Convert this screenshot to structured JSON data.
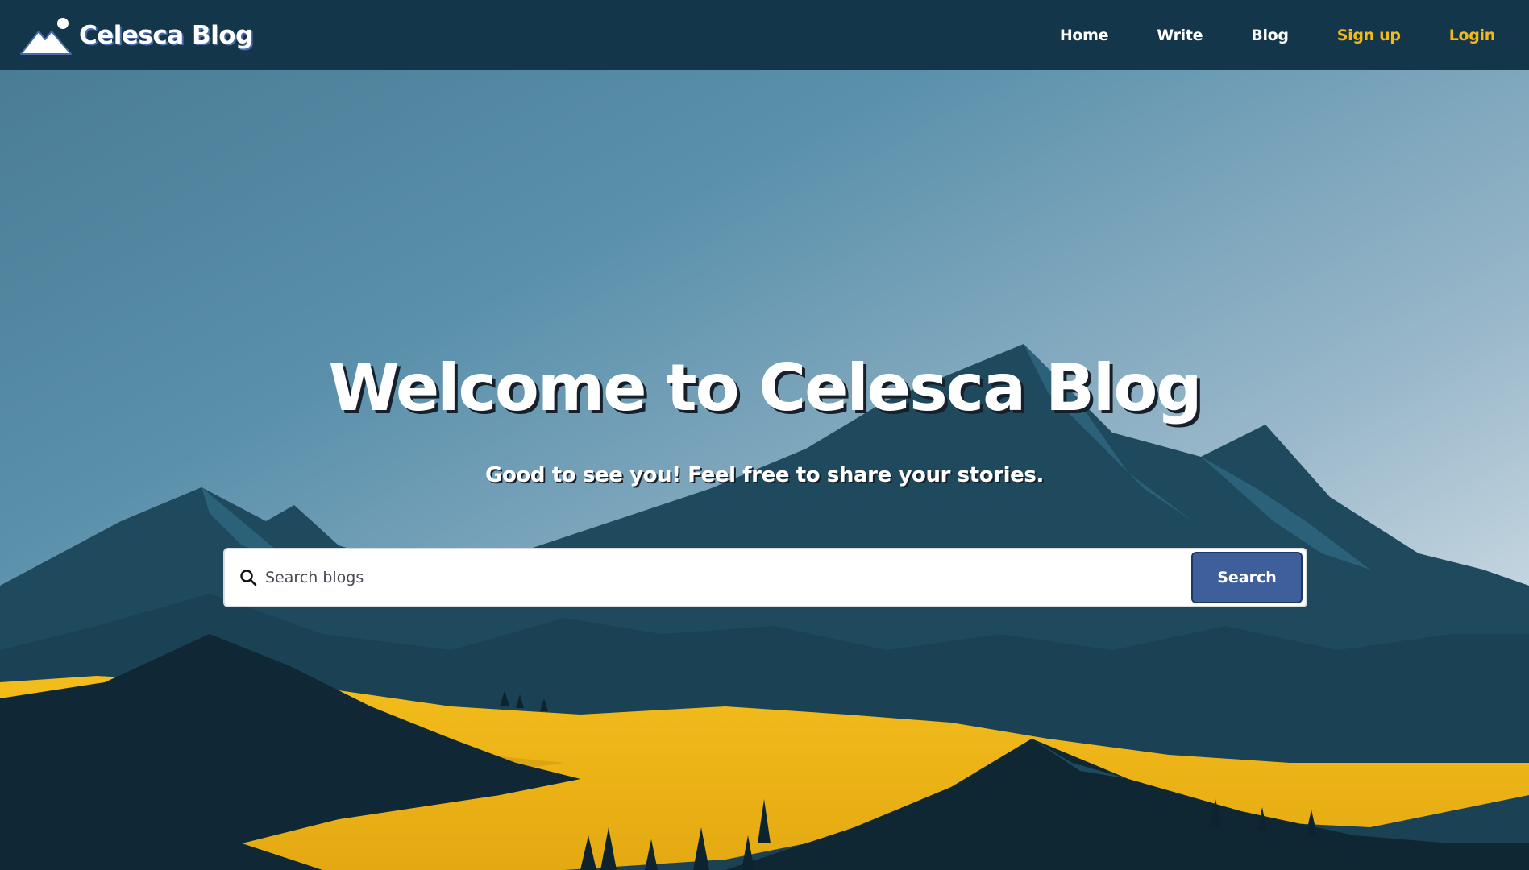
{
  "brand": {
    "name": "Celesca Blog",
    "icon": "mountain-logo-icon"
  },
  "nav": {
    "items": [
      {
        "label": "Home",
        "style": "default"
      },
      {
        "label": "Write",
        "style": "default"
      },
      {
        "label": "Blog",
        "style": "default"
      },
      {
        "label": "Sign up",
        "style": "accent"
      },
      {
        "label": "Login",
        "style": "accent"
      }
    ]
  },
  "hero": {
    "title": "Welcome to Celesca Blog",
    "subtitle": "Good to see you! Feel free to share your stories."
  },
  "search": {
    "placeholder": "Search blogs",
    "value": "",
    "button_label": "Search",
    "icon": "search-icon"
  },
  "colors": {
    "navbar": "#14364a",
    "accent": "#f2b91a",
    "button": "#3e5f9c",
    "sky_top": "#4f8aa6",
    "sky_bottom": "#eef2f5",
    "mountain_dark": "#0f2633",
    "mountain_mid": "#1d4a5f",
    "river": "#f0b716"
  }
}
